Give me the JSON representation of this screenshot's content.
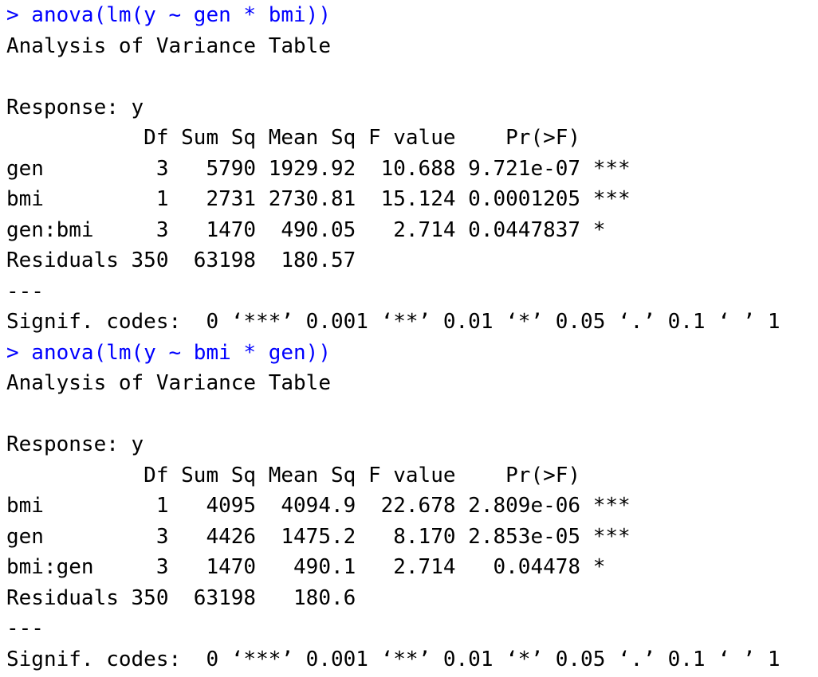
{
  "colors": {
    "command": "#0000ff",
    "output": "#000000",
    "background": "#ffffff"
  },
  "console": {
    "lines": [
      {
        "kind": "cmd",
        "text": "> anova(lm(y ~ gen * bmi))"
      },
      {
        "kind": "out",
        "text": "Analysis of Variance Table"
      },
      {
        "kind": "out",
        "text": ""
      },
      {
        "kind": "out",
        "text": "Response: y"
      },
      {
        "kind": "out",
        "text": "           Df Sum Sq Mean Sq F value    Pr(>F)    "
      },
      {
        "kind": "out",
        "text": "gen         3   5790 1929.92  10.688 9.721e-07 ***"
      },
      {
        "kind": "out",
        "text": "bmi         1   2731 2730.81  15.124 0.0001205 ***"
      },
      {
        "kind": "out",
        "text": "gen:bmi     3   1470  490.05   2.714 0.0447837 *  "
      },
      {
        "kind": "out",
        "text": "Residuals 350  63198  180.57                      "
      },
      {
        "kind": "out",
        "text": "---"
      },
      {
        "kind": "out",
        "text": "Signif. codes:  0 ‘***’ 0.001 ‘**’ 0.01 ‘*’ 0.05 ‘.’ 0.1 ‘ ’ 1"
      },
      {
        "kind": "cmd",
        "text": "> anova(lm(y ~ bmi * gen))"
      },
      {
        "kind": "out",
        "text": "Analysis of Variance Table"
      },
      {
        "kind": "out",
        "text": ""
      },
      {
        "kind": "out",
        "text": "Response: y"
      },
      {
        "kind": "out",
        "text": "           Df Sum Sq Mean Sq F value    Pr(>F)    "
      },
      {
        "kind": "out",
        "text": "bmi         1   4095  4094.9  22.678 2.809e-06 ***"
      },
      {
        "kind": "out",
        "text": "gen         3   4426  1475.2   8.170 2.853e-05 ***"
      },
      {
        "kind": "out",
        "text": "bmi:gen     3   1470   490.1   2.714   0.04478 *  "
      },
      {
        "kind": "out",
        "text": "Residuals 350  63198   180.6                      "
      },
      {
        "kind": "out",
        "text": "---"
      },
      {
        "kind": "out",
        "text": "Signif. codes:  0 ‘***’ 0.001 ‘**’ 0.01 ‘*’ 0.05 ‘.’ 0.1 ‘ ’ 1"
      }
    ]
  }
}
